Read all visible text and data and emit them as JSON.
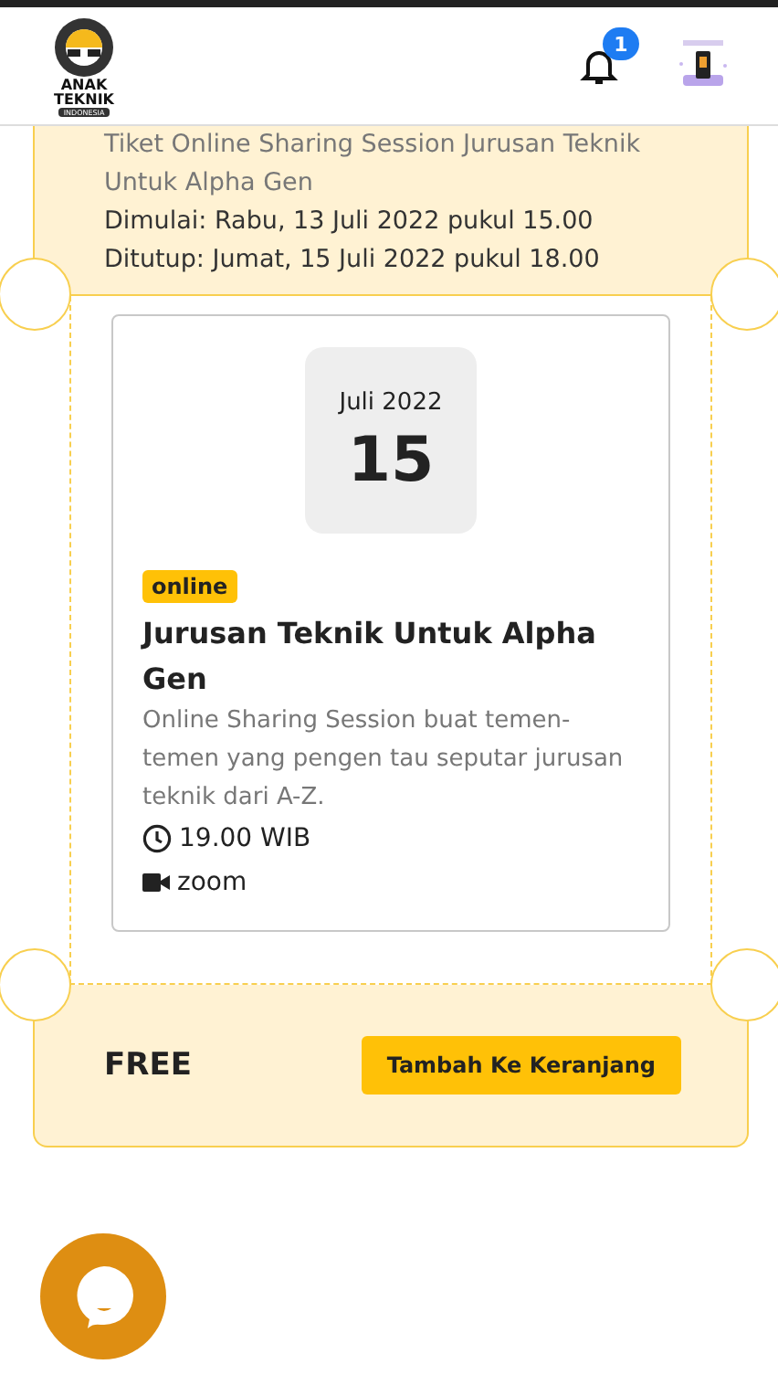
{
  "header": {
    "logo": {
      "line1": "ANAK",
      "line2": "TEKNIK",
      "line3": "INDONESIA"
    },
    "notification_count": "1"
  },
  "ticket": {
    "name": "Tiket Online Sharing Session Jurusan Teknik Untuk Alpha Gen",
    "start": "Dimulai: Rabu, 13 Juli 2022 pukul 15.00",
    "end": "Ditutup: Jumat, 15 Juli 2022 pukul 18.00"
  },
  "event": {
    "month": "Juli 2022",
    "day": "15",
    "badge": "online",
    "title": "Jurusan Teknik Untuk Alpha Gen",
    "description": "Online Sharing Session buat temen-temen yang pengen tau seputar jurusan teknik dari A-Z.",
    "time": "19.00 WIB",
    "platform": "zoom"
  },
  "price": "FREE",
  "cart_button": "Tambah Ke Keranjang"
}
